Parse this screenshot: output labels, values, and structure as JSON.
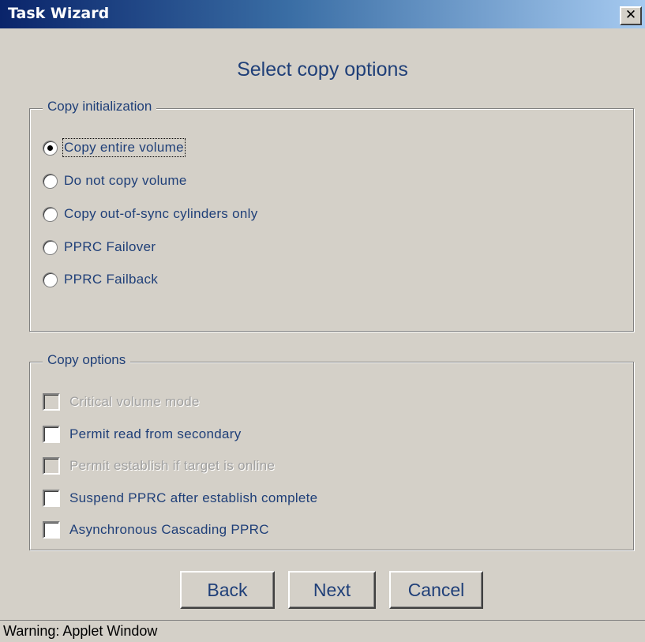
{
  "window": {
    "title": "Task Wizard",
    "close_glyph": "✕"
  },
  "heading": "Select copy options",
  "copy_initialization": {
    "legend": "Copy initialization",
    "options": [
      {
        "label": "Copy entire volume",
        "checked": true
      },
      {
        "label": "Do not copy volume",
        "checked": false
      },
      {
        "label": "Copy out-of-sync cylinders only",
        "checked": false
      },
      {
        "label": "PPRC Failover",
        "checked": false
      },
      {
        "label": "PPRC Failback",
        "checked": false
      }
    ]
  },
  "copy_options": {
    "legend": "Copy options",
    "options": [
      {
        "label": "Critical volume mode",
        "enabled": false,
        "checked": false
      },
      {
        "label": "Permit read from secondary",
        "enabled": true,
        "checked": false
      },
      {
        "label": "Permit establish if target is online",
        "enabled": false,
        "checked": false
      },
      {
        "label": "Suspend PPRC after establish complete",
        "enabled": true,
        "checked": false
      },
      {
        "label": "Asynchronous Cascading PPRC",
        "enabled": true,
        "checked": false
      }
    ]
  },
  "buttons": {
    "back": "Back",
    "next": "Next",
    "cancel": "Cancel"
  },
  "status": "Warning: Applet Window",
  "colors": {
    "titlebar_start": "#0a246a",
    "text_blue": "#1f3f78",
    "face": "#d4d0c8",
    "disabled_text": "#a0a0a0"
  }
}
